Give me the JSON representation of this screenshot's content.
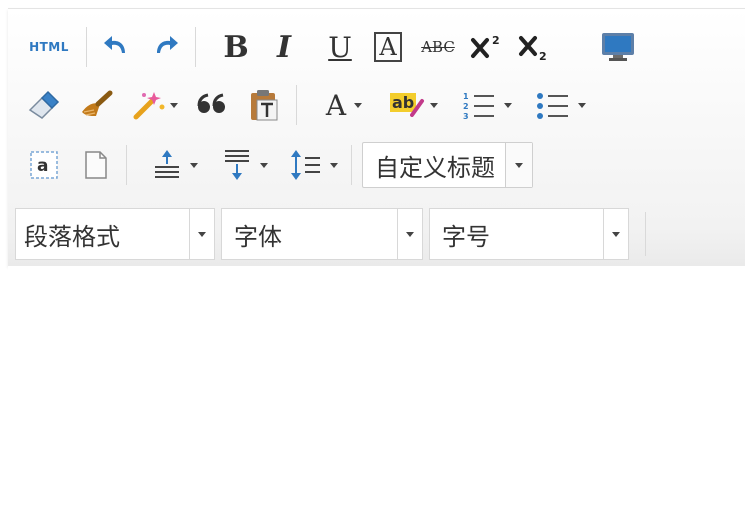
{
  "toolbar": {
    "row1": {
      "html_label": "HTML",
      "bold_label": "B",
      "italic_label": "I",
      "underline_label": "U",
      "border_label": "A",
      "strike_label": "ABC"
    },
    "row2": {
      "font_color_label": "A",
      "highlight_label": "ab"
    },
    "row3": {
      "custom_title_label": "自定义标题"
    },
    "row4": {
      "paragraph_label": "段落格式",
      "font_family_label": "字体",
      "font_size_label": "字号"
    }
  },
  "colors": {
    "blue_icon": "#2f79c1",
    "text": "#333333",
    "brush": "#c27a1a",
    "magic": "#e7a21d"
  }
}
